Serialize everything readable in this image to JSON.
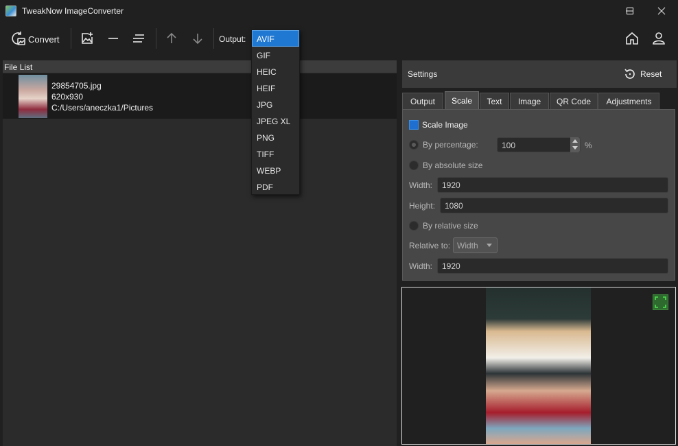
{
  "window": {
    "title": "TweakNow ImageConverter"
  },
  "toolbar": {
    "convert_label": "Convert",
    "output_label": "Output:",
    "output_selected": "AVIF",
    "output_options": [
      "AVIF",
      "GIF",
      "HEIC",
      "HEIF",
      "JPG",
      "JPEG XL",
      "PNG",
      "TIFF",
      "WEBP",
      "PDF"
    ]
  },
  "file_list": {
    "header": "File List",
    "files": [
      {
        "name": "29854705.jpg",
        "dimensions": "620x930",
        "path": "C:/Users/aneczka1/Pictures"
      }
    ]
  },
  "settings": {
    "title": "Settings",
    "reset_label": "Reset",
    "tabs": [
      "Output",
      "Scale",
      "Text",
      "Image",
      "QR Code",
      "Adjustments"
    ],
    "active_tab": "Scale",
    "scale": {
      "scale_image_label": "Scale Image",
      "scale_image_checked": true,
      "by_percentage_label": "By percentage:",
      "percentage_value": "100",
      "percent_unit": "%",
      "by_absolute_label": "By absolute size",
      "width_label": "Width:",
      "width_value": "1920",
      "height_label": "Height:",
      "height_value": "1080",
      "by_relative_label": "By relative size",
      "relative_to_label": "Relative to:",
      "relative_to_value": "Width",
      "relative_width_label": "Width:",
      "relative_width_value": "1920"
    }
  },
  "colors": {
    "accent": "#1f78d1",
    "background": "#202020",
    "panel": "#2b2b2b"
  }
}
